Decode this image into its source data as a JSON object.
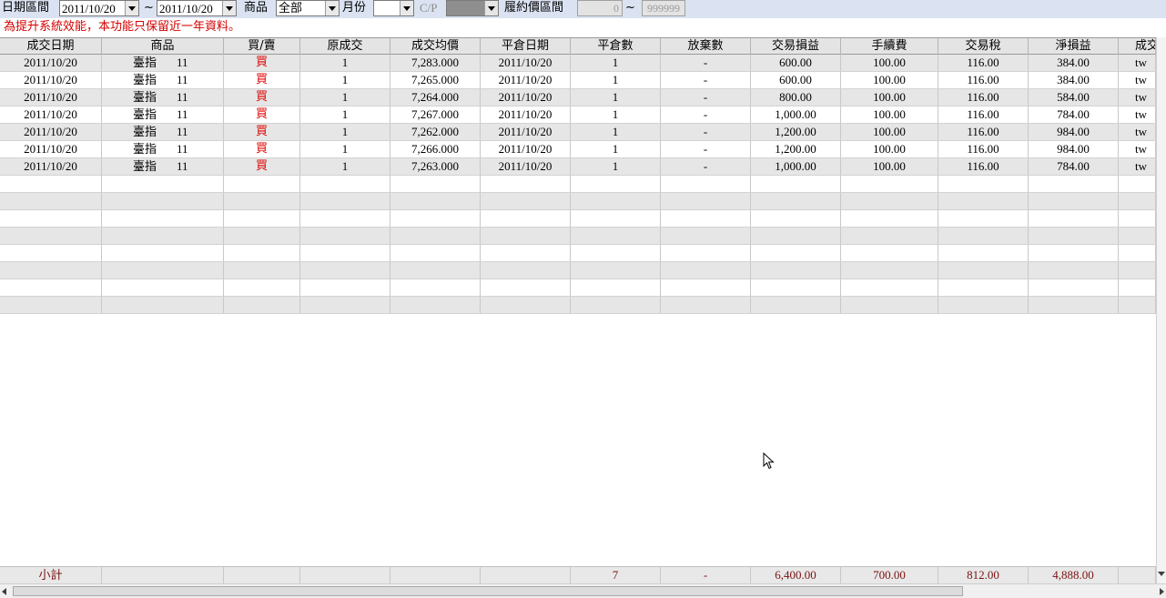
{
  "filters": {
    "date_range_label": "日期區間",
    "date_from": "2011/10/20",
    "tilde": "~",
    "date_to": "2011/10/20",
    "product_label": "商品",
    "product_value": "全部",
    "month_label": "月份",
    "month_value": "",
    "cp_label": "C/P",
    "cp_value": "",
    "strike_range_label": "履約價區間",
    "strike_from": "0",
    "strike_to": "999999"
  },
  "notice": "為提升系統效能，本功能只保留近一年資料。",
  "columns": [
    "成交日期",
    "商品",
    "買/賣",
    "原成交",
    "成交均價",
    "平倉日期",
    "平倉數",
    "放棄數",
    "交易損益",
    "手續費",
    "交易稅",
    "淨損益",
    "成交"
  ],
  "rows": [
    {
      "date": "2011/10/20",
      "product": "臺指",
      "month": "11",
      "side": "買",
      "orig": "1",
      "avg_price": "7,283.000",
      "close_date": "2011/10/20",
      "close_qty": "1",
      "abandon": "-",
      "pnl": "600.00",
      "fee": "100.00",
      "tax": "116.00",
      "net": "384.00",
      "trade": "tw"
    },
    {
      "date": "2011/10/20",
      "product": "臺指",
      "month": "11",
      "side": "買",
      "orig": "1",
      "avg_price": "7,265.000",
      "close_date": "2011/10/20",
      "close_qty": "1",
      "abandon": "-",
      "pnl": "600.00",
      "fee": "100.00",
      "tax": "116.00",
      "net": "384.00",
      "trade": "tw"
    },
    {
      "date": "2011/10/20",
      "product": "臺指",
      "month": "11",
      "side": "買",
      "orig": "1",
      "avg_price": "7,264.000",
      "close_date": "2011/10/20",
      "close_qty": "1",
      "abandon": "-",
      "pnl": "800.00",
      "fee": "100.00",
      "tax": "116.00",
      "net": "584.00",
      "trade": "tw"
    },
    {
      "date": "2011/10/20",
      "product": "臺指",
      "month": "11",
      "side": "買",
      "orig": "1",
      "avg_price": "7,267.000",
      "close_date": "2011/10/20",
      "close_qty": "1",
      "abandon": "-",
      "pnl": "1,000.00",
      "fee": "100.00",
      "tax": "116.00",
      "net": "784.00",
      "trade": "tw"
    },
    {
      "date": "2011/10/20",
      "product": "臺指",
      "month": "11",
      "side": "買",
      "orig": "1",
      "avg_price": "7,262.000",
      "close_date": "2011/10/20",
      "close_qty": "1",
      "abandon": "-",
      "pnl": "1,200.00",
      "fee": "100.00",
      "tax": "116.00",
      "net": "984.00",
      "trade": "tw"
    },
    {
      "date": "2011/10/20",
      "product": "臺指",
      "month": "11",
      "side": "買",
      "orig": "1",
      "avg_price": "7,266.000",
      "close_date": "2011/10/20",
      "close_qty": "1",
      "abandon": "-",
      "pnl": "1,200.00",
      "fee": "100.00",
      "tax": "116.00",
      "net": "984.00",
      "trade": "tw"
    },
    {
      "date": "2011/10/20",
      "product": "臺指",
      "month": "11",
      "side": "買",
      "orig": "1",
      "avg_price": "7,263.000",
      "close_date": "2011/10/20",
      "close_qty": "1",
      "abandon": "-",
      "pnl": "1,000.00",
      "fee": "100.00",
      "tax": "116.00",
      "net": "784.00",
      "trade": "tw"
    }
  ],
  "subtotal": {
    "label": "小計",
    "close_qty": "7",
    "abandon": "-",
    "pnl": "6,400.00",
    "fee": "700.00",
    "tax": "812.00",
    "net": "4,888.00"
  },
  "colors": {
    "header_bg": "#dbe3f2",
    "notice": "#d40000",
    "buy": "#e00000",
    "subtotal_text": "#7a1212"
  }
}
